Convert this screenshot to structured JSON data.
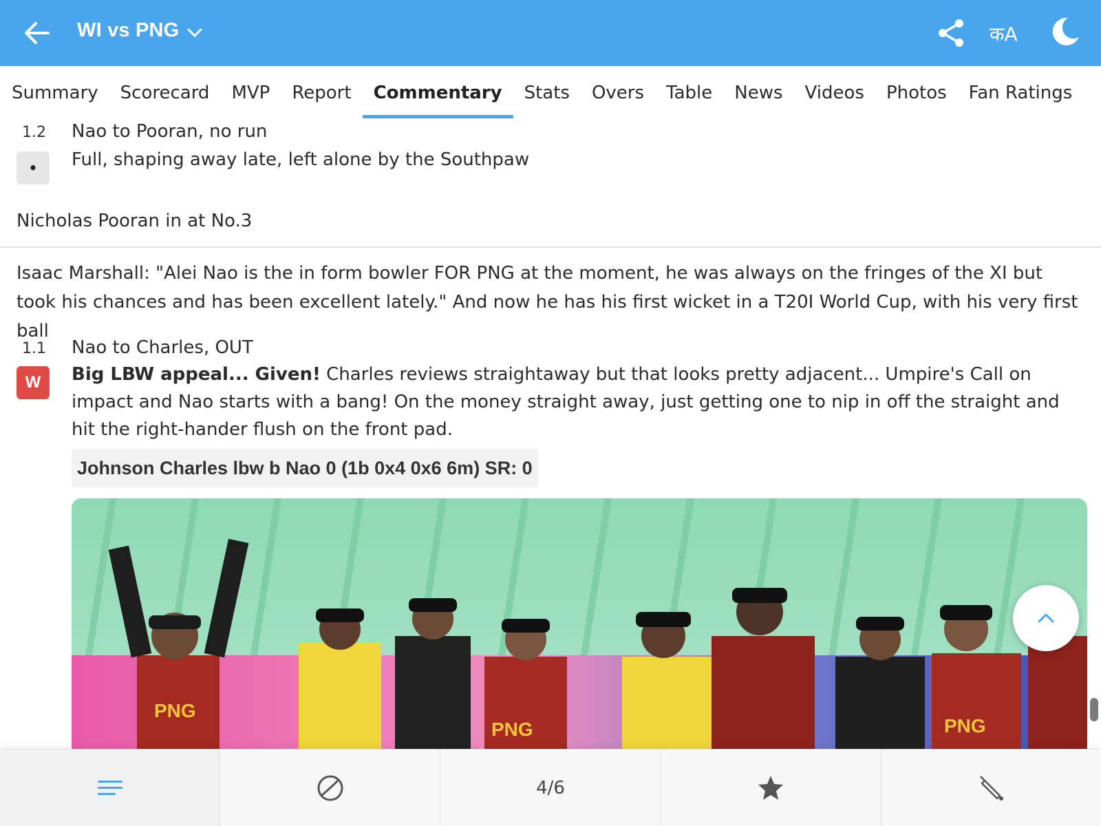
{
  "header": {
    "title": "WI vs PNG",
    "lang_label": "कA",
    "colors": {
      "bar": "#4aa6ec",
      "text": "#ffffff"
    },
    "icons": [
      "back-arrow-icon",
      "chevron-down-icon",
      "share-icon",
      "language-icon",
      "moon-icon"
    ]
  },
  "tabs": [
    {
      "label": "Summary",
      "active": false
    },
    {
      "label": "Scorecard",
      "active": false
    },
    {
      "label": "MVP",
      "active": false
    },
    {
      "label": "Report",
      "active": false
    },
    {
      "label": "Commentary",
      "active": true
    },
    {
      "label": "Stats",
      "active": false
    },
    {
      "label": "Overs",
      "active": false
    },
    {
      "label": "Table",
      "active": false
    },
    {
      "label": "News",
      "active": false
    },
    {
      "label": "Videos",
      "active": false
    },
    {
      "label": "Photos",
      "active": false
    },
    {
      "label": "Fan Ratings",
      "active": false
    }
  ],
  "commentary": {
    "ball_1_2": {
      "over": "1.2",
      "badge": "•",
      "title": "Nao to Pooran, no run",
      "text": "Full, shaping away late, left alone by the Southpaw"
    },
    "note_pooran": "Nicholas Pooran in at No.3",
    "note_marshall": "Isaac Marshall: \"Alei Nao is the in form bowler FOR PNG at the moment, he was always on the fringes of the XI but took his chances and has been excellent lately.\" And now he has his first wicket in a T20I World Cup, with his very first ball",
    "ball_1_1": {
      "over": "1.1",
      "badge": "W",
      "title": "Nao to Charles, OUT",
      "text_bold": "Big LBW appeal... Given!",
      "text": " Charles reviews straightaway but that looks pretty adjacent... Umpire's Call on impact and Nao starts with a bang! On the money straight away, just getting one to nip in off the straight and hit the right-hander flush on the front pad.",
      "dismissal": "Johnson Charles lbw b Nao 0 (1b 0x4 0x6 6m) SR: 0"
    }
  },
  "photo_text": {
    "shirt_1": "PNG",
    "shirt_2": "PNG",
    "shirt_3": "PNG"
  },
  "bottom_nav": {
    "counter": "4/6",
    "icons": [
      "menu-lines-icon",
      "ball-icon",
      "star-icon",
      "bat-icon"
    ]
  }
}
